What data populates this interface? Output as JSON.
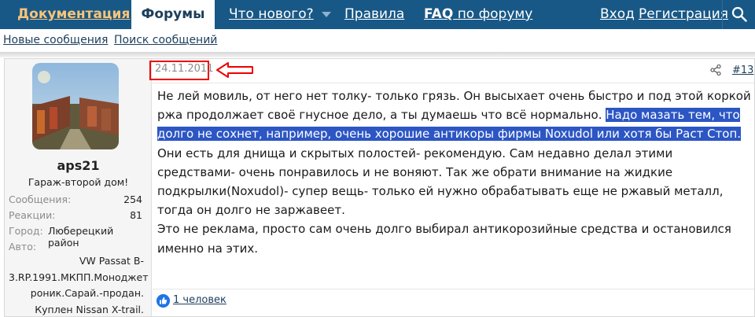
{
  "nav": {
    "tabs": [
      "Документация",
      "Форумы",
      "Что нового?",
      "Правила",
      "FAQ",
      "по форуму"
    ],
    "login": "Вход",
    "register": "Регистрация",
    "search_icon": "search-icon",
    "brand_color": "#185886",
    "accent_color": "#f9c479"
  },
  "subnav": {
    "new_posts": "Новые сообщения",
    "search_posts": "Поиск сообщений"
  },
  "user": {
    "name": "aps21",
    "title": "Гараж-второй дом!",
    "stats": [
      {
        "label": "Сообщения:",
        "value": "254"
      },
      {
        "label": "Реакции:",
        "value": "81"
      },
      {
        "label": "Город:",
        "value": "Люберецкий район"
      },
      {
        "label": "Авто:",
        "value": ""
      }
    ],
    "car_lines": [
      "VW Passat B-",
      "3.RP.1991.МКПП.Моноджет",
      "роник.Сарай.-продан.",
      "Куплен Nissan X-trail."
    ]
  },
  "post": {
    "date": "24.11.2011",
    "permalink": "#13",
    "text_before": "Не лей мовиль, от него нет толку- только грязь. Он высыхает очень быстро и под этой коркой ржа продолжает своё гнусное дело, а ты думаешь что всё нормально. ",
    "text_highlight": "Надо мазать тем, что долго не сохнет, например, очень хорошие антикоры фирмы Noxudol или хотя бы Раст Стоп.",
    "text_after": " Они есть для днища и скрытых полостей- рекомендую. Сам недавно делал этими средствами- очень понравилось и не воняют. Так же обрати внимание на жидкие подкрылки(Noxudol)- супер вещь- только ей нужно обрабатывать еще не ржавый металл, тогда он долго не заржавеет.",
    "text_second": "Это не реклама, просто сам очень долго выбирал антикорозийные средства и остановился именно на этих.",
    "highlight_color": "#2c56c4"
  },
  "reactions": {
    "text": "1 человек"
  }
}
